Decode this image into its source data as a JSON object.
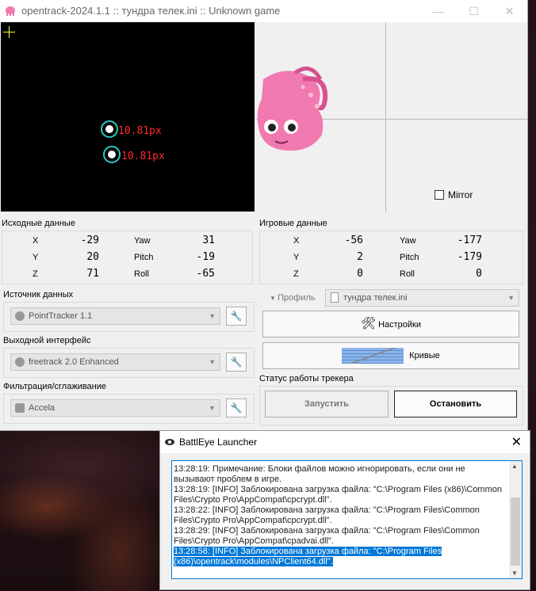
{
  "main_window": {
    "title": "opentrack-2024.1.1 :: тундра телек.ini :: Unknown game",
    "controls": {
      "minimize": "—",
      "maximize": "☐",
      "close": "✕"
    }
  },
  "video": {
    "points": [
      {
        "label": "10.81px"
      },
      {
        "label": "10.81px"
      }
    ]
  },
  "pose": {
    "mirror_label": "Mirror",
    "mirror_checked": false
  },
  "raw_data": {
    "title": "Исходные данные",
    "rows": [
      {
        "axis": "X",
        "axis_val": "-29",
        "rot": "Yaw",
        "rot_val": "31"
      },
      {
        "axis": "Y",
        "axis_val": "20",
        "rot": "Pitch",
        "rot_val": "-19"
      },
      {
        "axis": "Z",
        "axis_val": "71",
        "rot": "Roll",
        "rot_val": "-65"
      }
    ]
  },
  "game_data": {
    "title": "Игровые данные",
    "rows": [
      {
        "axis": "X",
        "axis_val": "-56",
        "rot": "Yaw",
        "rot_val": "-177"
      },
      {
        "axis": "Y",
        "axis_val": "2",
        "rot": "Pitch",
        "rot_val": "-179"
      },
      {
        "axis": "Z",
        "axis_val": "0",
        "rot": "Roll",
        "rot_val": "0"
      }
    ]
  },
  "source": {
    "title": "Источник данных",
    "value": "PointTracker 1.1"
  },
  "output": {
    "title": "Выходной интерфейс",
    "value": "freetrack 2.0 Enhanced"
  },
  "filter": {
    "title": "Фильтрация/сглаживание",
    "value": "Accela"
  },
  "profile": {
    "label": "Профиль",
    "value": "тундра телек.ini"
  },
  "buttons": {
    "settings": "Настройки",
    "curves": "Кривые",
    "start": "Запустить",
    "stop": "Остановить"
  },
  "tracker_status": "Статус работы трекера",
  "battleye": {
    "title": "BattlEye Launcher",
    "close": "✕",
    "log": [
      {
        "text": "13:28:19: Примечание: Блоки файлов можно игнорировать, если они не вызывают проблем в игре.",
        "selected": false
      },
      {
        "text": "13:28:19: [INFO] Заблокирована загрузка файла: \"C:\\Program Files (x86)\\Common Files\\Crypto Pro\\AppCompat\\cpcrypt.dll\".",
        "selected": false
      },
      {
        "text": "13:28:22: [INFO] Заблокирована загрузка файла: \"C:\\Program Files\\Common Files\\Crypto Pro\\AppCompat\\cpcrypt.dll\".",
        "selected": false
      },
      {
        "text": "13:28:29: [INFO] Заблокирована загрузка файла: \"C:\\Program Files\\Common Files\\Crypto Pro\\AppCompat\\cpadvai.dll\".",
        "selected": false
      },
      {
        "text": "13:28:58: [INFO] Заблокирована загрузка файла: \"C:\\Program Files (x86)\\opentrack\\modules\\NPClient64.dll\".",
        "selected": true
      }
    ]
  },
  "colors": {
    "blob_ring": "#2cc8c0",
    "blob_label": "#ff2a2a",
    "crosshair": "#ffff33",
    "selection": "#0078d7",
    "octopus": "#f07ab0"
  }
}
